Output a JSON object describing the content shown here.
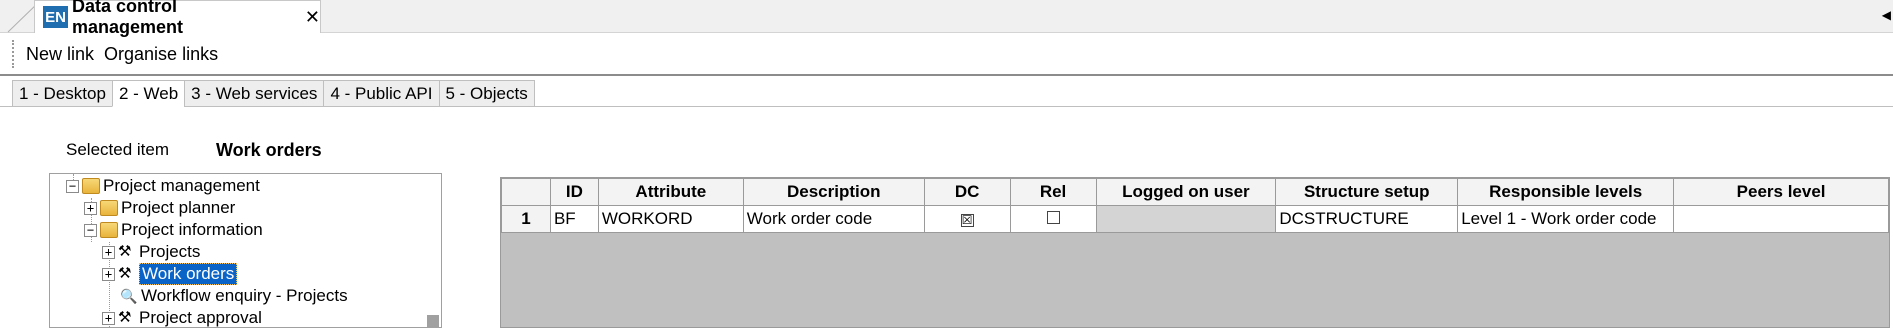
{
  "tabbar": {
    "badge": "EN",
    "title": "Data control management",
    "close": "✕",
    "scroll": "◀"
  },
  "toolbar": {
    "new_link": "New link",
    "organise_links": "Organise links"
  },
  "section_tabs": [
    "1 - Desktop",
    "2 - Web",
    "3 - Web services",
    "4 - Public API",
    "5 - Objects"
  ],
  "selected": {
    "label": "Selected item",
    "value": "Work orders"
  },
  "tree": {
    "items": [
      {
        "label": "Project management",
        "expander": "−"
      },
      {
        "label": "Project planner",
        "expander": "+"
      },
      {
        "label": "Project information",
        "expander": "−"
      },
      {
        "label": "Projects",
        "expander": "+"
      },
      {
        "label": "Work orders",
        "expander": "+"
      },
      {
        "label": "Workflow enquiry - Projects",
        "expander": ""
      },
      {
        "label": "Project approval",
        "expander": "+"
      }
    ]
  },
  "grid": {
    "columns": [
      "",
      "ID",
      "Attribute",
      "Description",
      "DC",
      "Rel",
      "Logged on user",
      "Structure setup",
      "Responsible levels",
      "Peers level"
    ],
    "rows": [
      {
        "num": "1",
        "id": "BF",
        "attribute": "WORKORD",
        "description": "Work order code",
        "dc": "☒",
        "rel": "",
        "logged_on_user": "",
        "structure_setup": "DCSTRUCTURE",
        "responsible_levels": "Level 1 - Work order code",
        "peers_level": ""
      }
    ]
  }
}
